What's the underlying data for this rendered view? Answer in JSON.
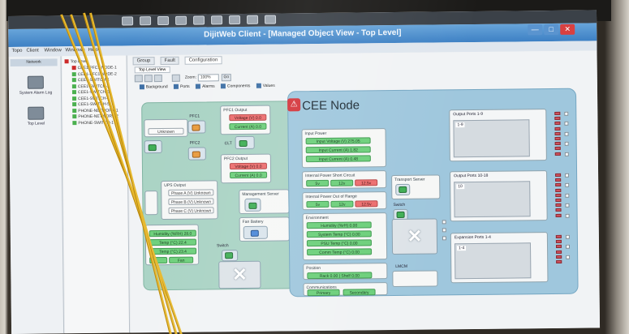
{
  "window": {
    "title": "DijitWeb Client - [Managed Object View - Top Level]"
  },
  "menu": {
    "items": [
      "Topo",
      "Client",
      "Window",
      "Windows",
      "Help"
    ]
  },
  "nav": {
    "tab_label": "Network",
    "items": [
      {
        "label": "System Alarm Log",
        "icon": "alarm-log-icon"
      },
      {
        "label": "Top Level",
        "icon": "topology-icon"
      }
    ]
  },
  "tree": {
    "root": "Top Level",
    "items": [
      "CEE1-PFC1-NODE-1",
      "CEE1-PFC1-NODE-2",
      "CEE1-SWITCH-1",
      "CEE1-SWITCH-2",
      "CEE1-SWITCH-3",
      "CEE1-SWITCH-4",
      "CEE1-SWITCH-5",
      "PHONE-NETWORK-1",
      "PHONE-NETWORK-2",
      "PHONE-SWITCH-1"
    ],
    "colors": [
      "#cc2a2a",
      "#4bb04f",
      "#4bb04f",
      "#4bb04f",
      "#4bb04f",
      "#4bb04f",
      "#4bb04f",
      "#4bb04f",
      "#4bb04f",
      "#4bb04f"
    ]
  },
  "tabs": [
    "Group",
    "Fault",
    "Configuration"
  ],
  "subtab": "Top Level View",
  "toolbar": {
    "zoom_label": "Zoom:",
    "zoom_value": "100%",
    "go_label": "Go"
  },
  "layers": [
    "Background",
    "Ports",
    "Alarms",
    "Components",
    "Values"
  ],
  "left_panel": {
    "pfc1": "PFC1",
    "pfc2": "PFC2",
    "ups": "UPS",
    "unknown": "Unknown",
    "pfc1_output": {
      "title": "PFC1 Output",
      "voltage": "Voltage (V) 0.0",
      "current": "Current (A) 0.0"
    },
    "pfc2_output": {
      "title": "PFC2 Output",
      "voltage": "Voltage (V) 0.0",
      "current": "Current (A) 0.0"
    },
    "clt": "CLT",
    "ups_output": {
      "title": "UPS Output",
      "phases": [
        "Phase A (V) Unknown",
        "Phase B (V) Unknown",
        "Phase C (V) Unknown"
      ]
    },
    "mgmt_server": "Management Server",
    "fan_battery": "Fan Battery",
    "env": {
      "rows": [
        "Humidity (%RH) 28.0",
        "Temp (°C) 22.4",
        "Temp (°C) 23.4"
      ],
      "fan": "Fan"
    },
    "switch": "Switch"
  },
  "node": {
    "title": "CEE Node",
    "input_power": {
      "title": "Input Power",
      "rows": [
        "Input Voltage (V) 275.05",
        "Input Current (A) 1.82",
        "Input Current (A) 0.48"
      ]
    },
    "short_circuit": {
      "title": "Internal Power Short Circuit",
      "cells": [
        "5v",
        "12v",
        "12.5v"
      ]
    },
    "out_of_range": {
      "title": "Internal Power Out of Range",
      "cells": [
        "5v",
        "12v",
        "12.5v"
      ]
    },
    "environment": {
      "title": "Environment",
      "rows": [
        "Humidity (%rH) 0.00",
        "System Temp (°C) 0.00",
        "PSU Temp (°C) 0.00",
        "Comm Temp (°C) 0.00"
      ]
    },
    "position": {
      "title": "Position",
      "value": "Rack 0.00 | Shelf 0.00"
    },
    "communications": {
      "title": "Communications",
      "buttons": [
        "Primary",
        "Secondary"
      ]
    },
    "transport_server": "Transport Server",
    "switch": "Switch",
    "lmcm": "LMCM",
    "output_ports_1": {
      "title": "Output Ports 1-9",
      "number": "1-9"
    },
    "output_ports_2": {
      "title": "Output Ports 10-18",
      "number": "10"
    },
    "expansion_ports": {
      "title": "Expansion Ports 1-4",
      "number": "1-4"
    }
  },
  "colors": {
    "accent": "#3d80c4",
    "ok": "#6ccf7a",
    "alarm": "#ec6d6d",
    "node_panel": "#9fc7dd",
    "aux_panel": "#a9d3c4"
  }
}
